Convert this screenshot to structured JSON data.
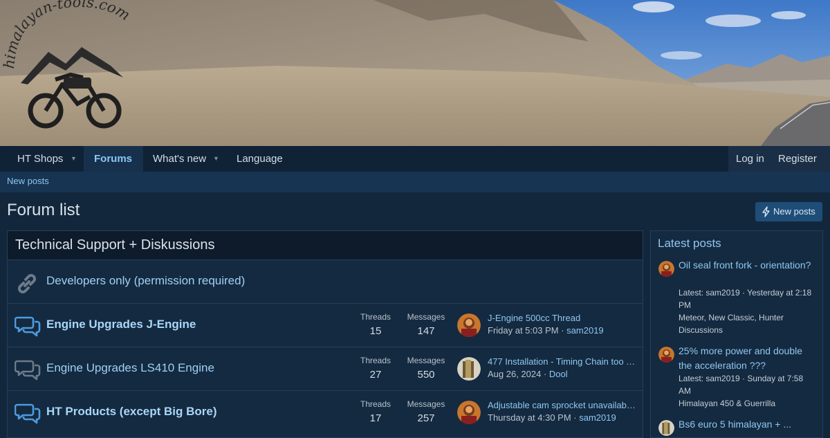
{
  "banner": {
    "logo_text": "himalayan-tools.com"
  },
  "nav": {
    "items": [
      {
        "label": "HT Shops",
        "has_caret": true
      },
      {
        "label": "Forums",
        "active": true
      },
      {
        "label": "What's new",
        "has_caret": true
      },
      {
        "label": "Language"
      }
    ],
    "login": "Log in",
    "register": "Register"
  },
  "subnav": {
    "new_posts": "New posts"
  },
  "page": {
    "title": "Forum list",
    "new_posts_button": "New posts"
  },
  "category": {
    "title": "Technical Support + Diskussions",
    "stat_threads_label": "Threads",
    "stat_messages_label": "Messages",
    "nodes": [
      {
        "title": "Developers only (permission required)",
        "icon": "link-icon",
        "unread": false
      },
      {
        "title": "Engine Upgrades J-Engine",
        "icon": "chat-bubbles-icon",
        "unread": true,
        "threads": "15",
        "messages": "147",
        "last_title": "J-Engine 500cc Thread",
        "last_date": "Friday at 5:03 PM",
        "last_user": "sam2019"
      },
      {
        "title": "Engine Upgrades LS410 Engine",
        "icon": "chat-bubbles-icon",
        "unread": false,
        "threads": "27",
        "messages": "550",
        "last_title": "477 Installation - Timing Chain too s...",
        "last_date": "Aug 26, 2024",
        "last_user": "Dool"
      },
      {
        "title": "HT Products (except Big Bore)",
        "icon": "chat-bubbles-icon",
        "unread": true,
        "threads": "17",
        "messages": "257",
        "last_title": "Adjustable cam sprocket unavailabl...",
        "last_date": "Thursday at 4:30 PM",
        "last_user": "sam2019"
      }
    ]
  },
  "sidebar": {
    "title": "Latest posts",
    "posts": [
      {
        "title": "Oil seal front fork - orientation?",
        "meta": "Latest: sam2019 · Yesterday at 2:18 PM",
        "forum": "Meteor, New Classic, Hunter Discussions"
      },
      {
        "title": "25% more power and double the acceleration ???",
        "meta": "Latest: sam2019 · Sunday at 7:58 AM",
        "forum": "Himalayan 450 & Guerrilla"
      },
      {
        "title": "Bs6 euro 5 himalayan + ...",
        "meta": "",
        "forum": ""
      }
    ]
  },
  "colors": {
    "background": "#13273c",
    "link": "#8fc7f2",
    "nav_active": "#8cc6f3",
    "button": "#1e4d78"
  }
}
